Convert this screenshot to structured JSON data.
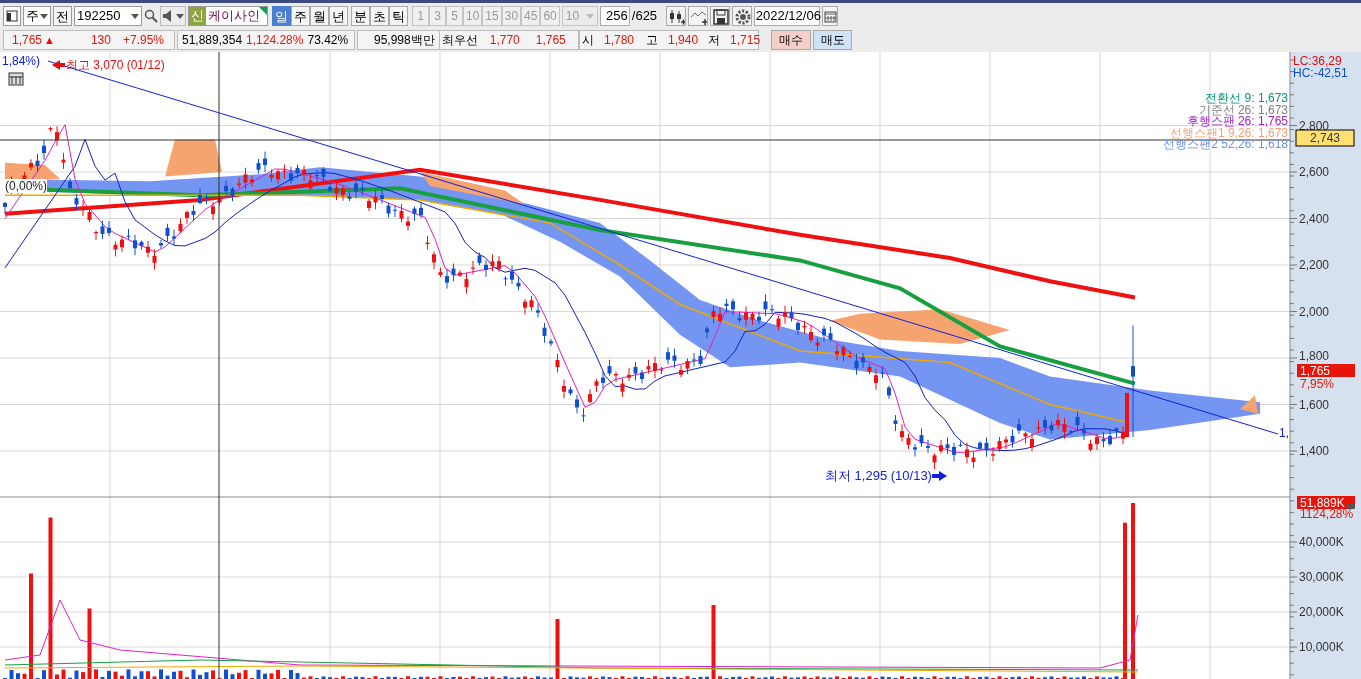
{
  "toolbar": {
    "market": "주",
    "prefix": "전",
    "code": "192250",
    "badge": "신",
    "name": "케이사인",
    "periods": [
      {
        "label": "일",
        "selected": true
      },
      {
        "label": "주",
        "selected": false
      },
      {
        "label": "월",
        "selected": false
      },
      {
        "label": "년",
        "selected": false
      },
      {
        "label": "분",
        "selected": false
      },
      {
        "label": "초",
        "selected": false
      },
      {
        "label": "틱",
        "selected": false
      }
    ],
    "intervals": [
      {
        "label": "1",
        "disabled": true
      },
      {
        "label": "3",
        "disabled": true
      },
      {
        "label": "5",
        "disabled": true
      },
      {
        "label": "10",
        "disabled": true
      },
      {
        "label": "15",
        "disabled": true
      },
      {
        "label": "30",
        "disabled": true
      },
      {
        "label": "45",
        "disabled": true
      },
      {
        "label": "60",
        "disabled": true
      }
    ],
    "interval_count": "10",
    "count": "256",
    "total": "/625",
    "date": "2022/12/06"
  },
  "quote": {
    "price": "1,765",
    "arrow": "▲",
    "change": "130",
    "rate": "+7.95%",
    "volume": "51,889,354",
    "volume_rate": "1,124.28%",
    "turnover": "73.42%",
    "amount": "95,998백만",
    "best_label": "최우선",
    "best_ask": "1,770",
    "best_bid": "1,765",
    "open_label": "시",
    "open": "1,780",
    "high_label": "고",
    "high": "1,940",
    "low_label": "저",
    "low": "1,715",
    "buy": "매수",
    "sell": "매도"
  },
  "chart": {
    "lc": "LC:36,29",
    "hc": "HC:-42,51",
    "legend": [
      {
        "text": "전환선 9: 1,673",
        "color": "#00957a"
      },
      {
        "text": "기준선 26: 1,673",
        "color": "#808080"
      },
      {
        "text": "후행스팬 26: 1,765",
        "color": "#a020c8"
      },
      {
        "text": "선행스팬1 9,26: 1,673",
        "color": "#f5a070"
      },
      {
        "text": "선행스팬2 52,26: 1,618",
        "color": "#6a8ee8"
      }
    ],
    "price_ticks": [
      "2,800",
      "2,600",
      "2,400",
      "2,200",
      "2,000",
      "1,800",
      "1,600",
      "1,400"
    ],
    "line_tag": "2,743",
    "price_tag": "1,765",
    "price_rate": "7,95%",
    "left_top": "1,84%)",
    "left_mid": "(0,00%)",
    "high_note": "최고 3,070 (01/12)",
    "low_note": "최저 1,295 (10/13)",
    "trend_label": "1,",
    "volume_tag": "51,889K",
    "volume_rate": "1124,28%",
    "volume_ticks": [
      "40,000K",
      "30,000K",
      "20,000K",
      "10,000K"
    ]
  }
}
